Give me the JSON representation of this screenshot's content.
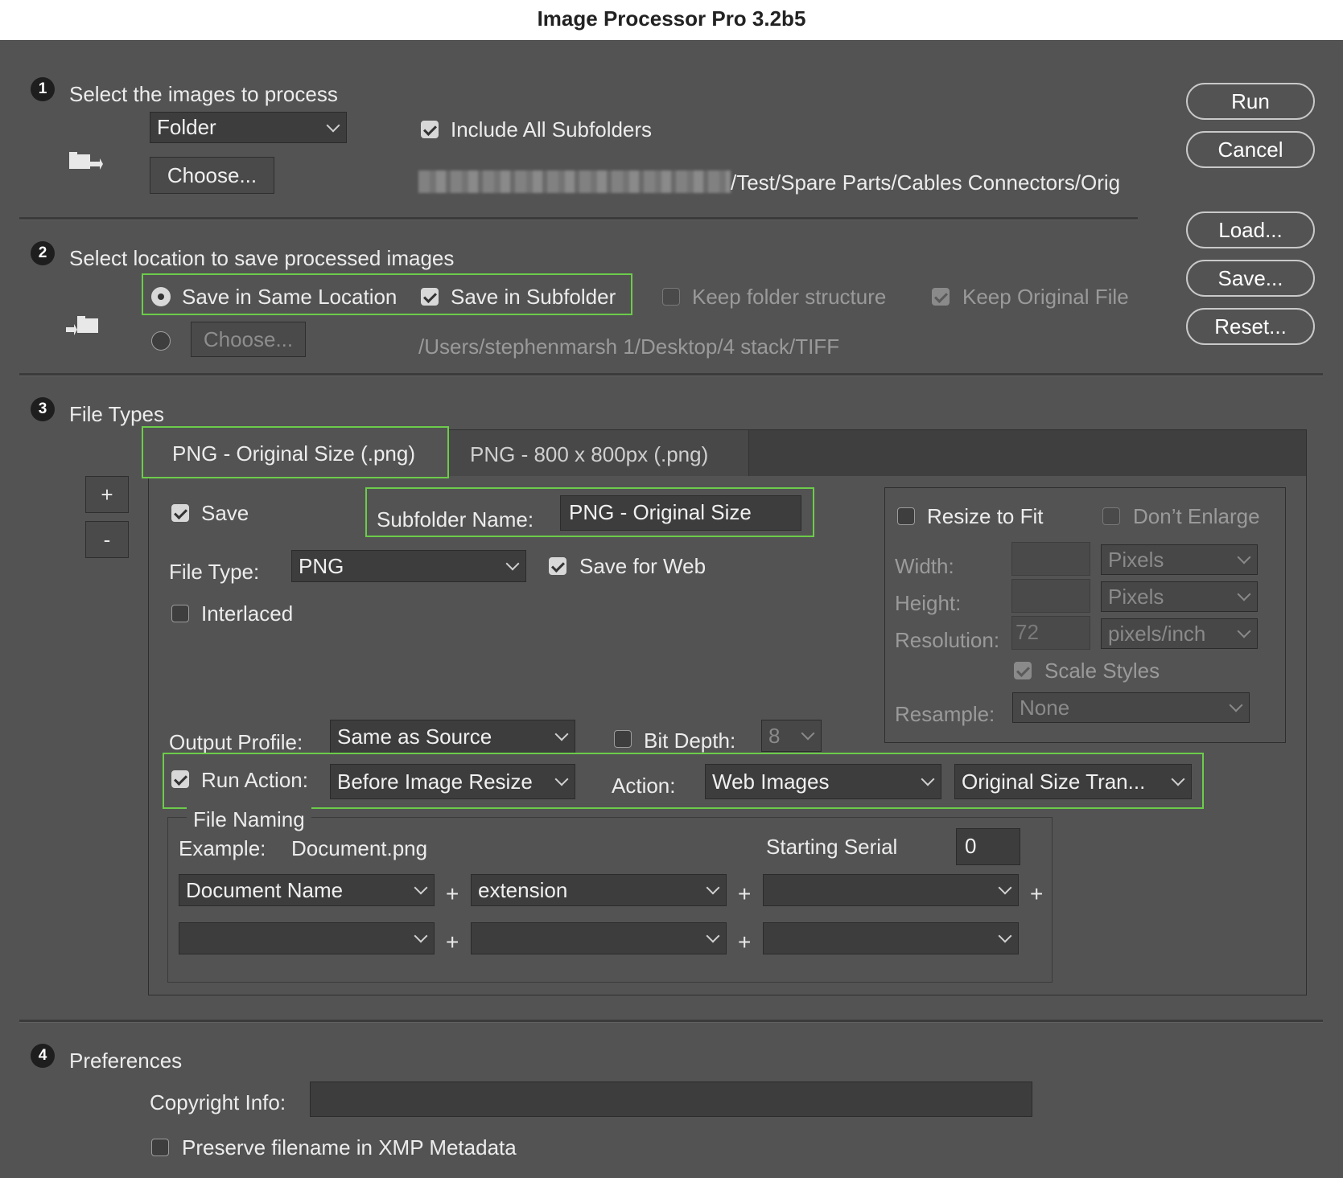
{
  "window": {
    "title": "Image Processor Pro 3.2b5"
  },
  "sidebar_buttons": {
    "run": "Run",
    "cancel": "Cancel",
    "load": "Load...",
    "save": "Save...",
    "reset": "Reset..."
  },
  "section1": {
    "number": "1",
    "heading": "Select the images to process",
    "source_select": "Folder",
    "choose_button": "Choose...",
    "include_subfolders_label": "Include All Subfolders",
    "include_subfolders_checked": true,
    "path": "/Test/Spare Parts/Cables  Connectors/Orig"
  },
  "section2": {
    "number": "2",
    "heading": "Select location to save processed images",
    "same_location_label": "Save in Same Location",
    "save_subfolder_label": "Save in Subfolder",
    "keep_structure_label": "Keep folder structure",
    "keep_original_label": "Keep Original File",
    "choose_button": "Choose...",
    "path": "/Users/stephenmarsh 1/Desktop/4 stack/TIFF"
  },
  "section3": {
    "number": "3",
    "heading": "File Types",
    "tabs": [
      {
        "label": "PNG - Original Size (.png)",
        "active": true
      },
      {
        "label": "PNG - 800 x 800px (.png)",
        "active": false
      }
    ],
    "add_button": "+",
    "remove_button": "-",
    "save_label": "Save",
    "subfolder_name_label": "Subfolder Name:",
    "subfolder_name_value": "PNG - Original Size",
    "file_type_label": "File Type:",
    "file_type_value": "PNG",
    "save_for_web_label": "Save for Web",
    "interlaced_label": "Interlaced",
    "resize": {
      "resize_to_fit_label": "Resize to Fit",
      "dont_enlarge_label": "Don’t Enlarge",
      "width_label": "Width:",
      "height_label": "Height:",
      "resolution_label": "Resolution:",
      "resolution_value": "72",
      "width_unit": "Pixels",
      "height_unit": "Pixels",
      "resolution_unit": "pixels/inch",
      "scale_styles_label": "Scale Styles",
      "resample_label": "Resample:",
      "resample_value": "None"
    },
    "output_profile_label": "Output Profile:",
    "output_profile_value": "Same as Source",
    "bit_depth_label": "Bit Depth:",
    "bit_depth_value": "8",
    "run_action_label": "Run Action:",
    "run_action_when": "Before Image Resize",
    "action_label": "Action:",
    "action_set": "Web Images",
    "action_name": "Original Size Tran...",
    "file_naming": {
      "legend": "File Naming",
      "example_label": "Example:",
      "example_value": "Document.png",
      "starting_serial_label": "Starting Serial",
      "starting_serial_value": "0",
      "row1": [
        "Document Name",
        "extension",
        ""
      ],
      "row2": [
        "",
        "",
        ""
      ],
      "plus": "+"
    }
  },
  "section4": {
    "number": "4",
    "heading": "Preferences",
    "copyright_label": "Copyright Info:",
    "copyright_value": "",
    "preserve_label": "Preserve filename in XMP Metadata"
  },
  "colors": {
    "highlight": "#6ccc4a",
    "background": "#535353"
  }
}
